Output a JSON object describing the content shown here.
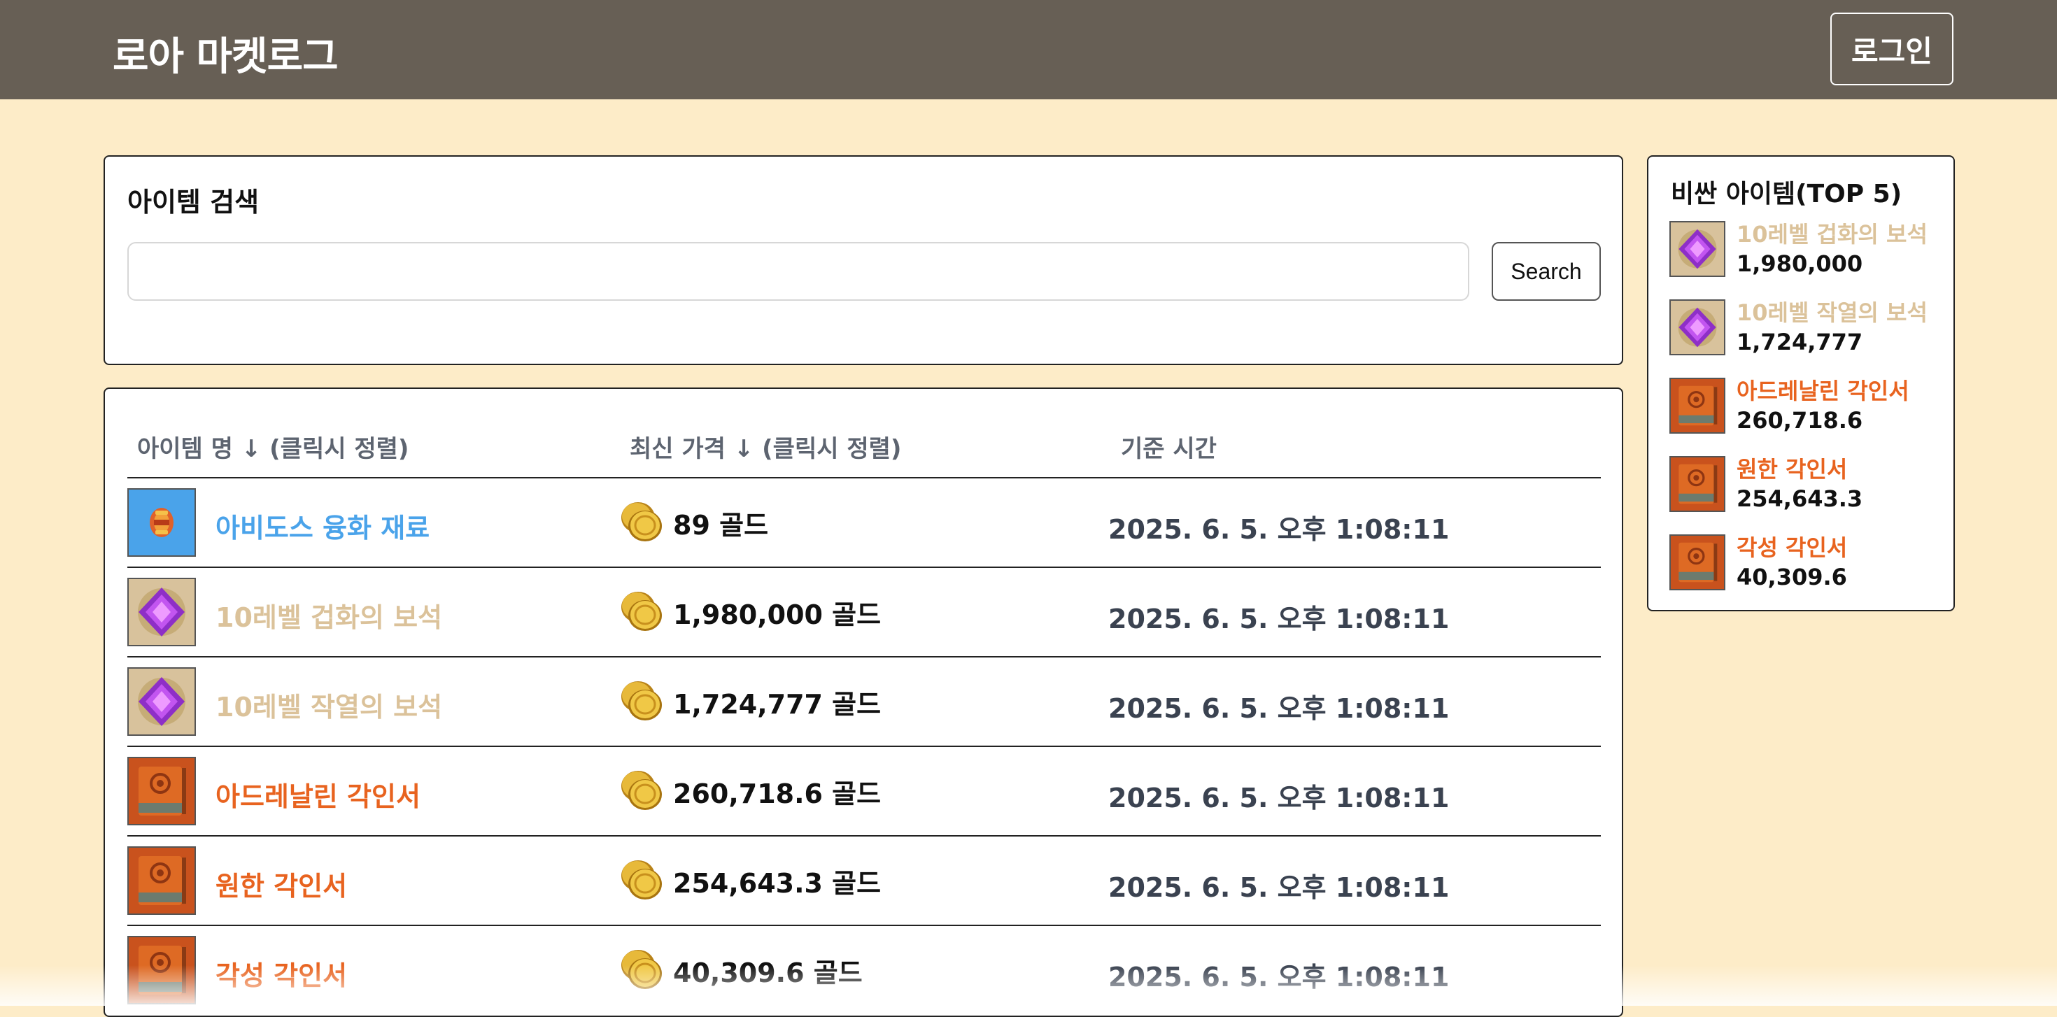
{
  "header": {
    "brand": "로아 마켓로그",
    "login_label": "로그인"
  },
  "search": {
    "title": "아이템 검색",
    "input_value": "",
    "placeholder": "",
    "button_label": "Search"
  },
  "table": {
    "headers": {
      "name": "아이템 명 ↓ (클릭시 정렬)",
      "price": "최신 가격 ↓ (클릭시 정렬)",
      "time": "기준 시간"
    },
    "rows": [
      {
        "name": "아비도스 융화 재료",
        "price": "89 골드",
        "time": "2025. 6. 5. 오후 1:08:11",
        "grade_color": "#4aa3ea",
        "icon": "fusion-material-icon"
      },
      {
        "name": "10레벨 겁화의 보석",
        "price": "1,980,000 골드",
        "time": "2025. 6. 5. 오후 1:08:11",
        "grade_color": "#dbc29a",
        "icon": "gem-icon"
      },
      {
        "name": "10레벨 작열의 보석",
        "price": "1,724,777 골드",
        "time": "2025. 6. 5. 오후 1:08:11",
        "grade_color": "#dbc29a",
        "icon": "gem-icon"
      },
      {
        "name": "아드레날린 각인서",
        "price": "260,718.6 골드",
        "time": "2025. 6. 5. 오후 1:08:11",
        "grade_color": "#e8631f",
        "icon": "engraving-book-icon"
      },
      {
        "name": "원한 각인서",
        "price": "254,643.3 골드",
        "time": "2025. 6. 5. 오후 1:08:11",
        "grade_color": "#e8631f",
        "icon": "engraving-book-icon"
      },
      {
        "name": "각성 각인서",
        "price": "40,309.6 골드",
        "time": "2025. 6. 5. 오후 1:08:11",
        "grade_color": "#e8631f",
        "icon": "engraving-book-icon"
      }
    ]
  },
  "top5": {
    "title": "비싼 아이템(TOP 5)",
    "items": [
      {
        "name": "10레벨 겁화의 보석",
        "price": "1,980,000",
        "grade_color": "#dbc29a",
        "icon": "gem-icon"
      },
      {
        "name": "10레벨 작열의 보석",
        "price": "1,724,777",
        "grade_color": "#dbc29a",
        "icon": "gem-icon"
      },
      {
        "name": "아드레날린 각인서",
        "price": "260,718.6",
        "grade_color": "#e8631f",
        "icon": "engraving-book-icon"
      },
      {
        "name": "원한 각인서",
        "price": "254,643.3",
        "grade_color": "#e8631f",
        "icon": "engraving-book-icon"
      },
      {
        "name": "각성 각인서",
        "price": "40,309.6",
        "grade_color": "#e8631f",
        "icon": "engraving-book-icon"
      }
    ]
  }
}
